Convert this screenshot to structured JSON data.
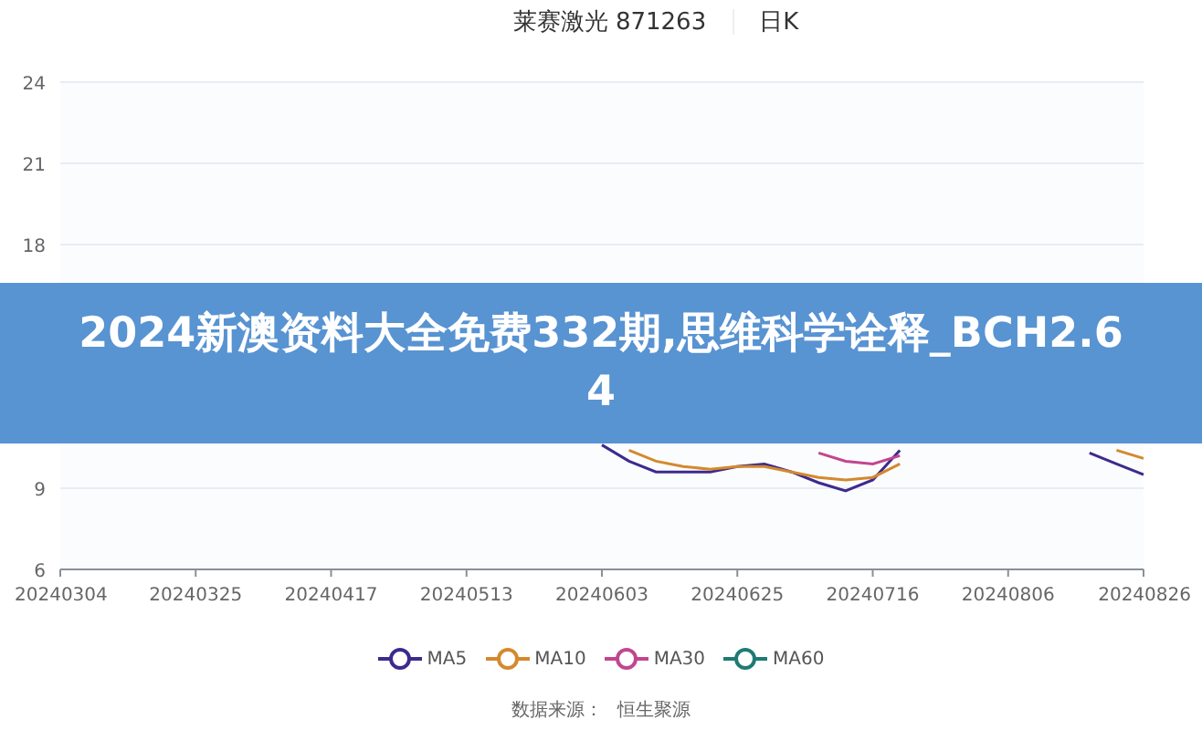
{
  "header": {
    "title": "莱赛激光 871263",
    "period": "日K"
  },
  "chart": {
    "chart_data": {
      "type": "line",
      "grid": true,
      "ylim": [
        6,
        24
      ],
      "yticks": [
        6,
        9,
        18,
        21,
        24
      ],
      "categories": [
        "20240304",
        null,
        null,
        null,
        null,
        "20240325",
        null,
        null,
        null,
        null,
        "20240417",
        null,
        null,
        null,
        null,
        "20240513",
        null,
        null,
        null,
        null,
        "20240603",
        null,
        null,
        null,
        null,
        "20240625",
        null,
        null,
        null,
        null,
        "20240716",
        null,
        null,
        null,
        null,
        "20240806",
        null,
        null,
        null,
        null,
        "20240826"
      ],
      "series": [
        {
          "name": "MA5",
          "color": "#3d2a8c",
          "values": [
            null,
            null,
            null,
            null,
            null,
            null,
            null,
            null,
            null,
            null,
            null,
            null,
            null,
            null,
            null,
            null,
            null,
            null,
            null,
            null,
            10.6,
            10.0,
            9.6,
            9.6,
            9.6,
            9.8,
            9.9,
            9.6,
            9.2,
            8.9,
            9.3,
            10.4,
            null,
            null,
            null,
            null,
            null,
            null,
            10.3,
            9.9,
            9.5
          ]
        },
        {
          "name": "MA10",
          "color": "#d4892e",
          "values": [
            null,
            null,
            null,
            null,
            null,
            null,
            null,
            null,
            null,
            null,
            null,
            null,
            null,
            null,
            null,
            null,
            null,
            null,
            null,
            null,
            null,
            10.4,
            10.0,
            9.8,
            9.7,
            9.8,
            9.8,
            9.6,
            9.4,
            9.3,
            9.4,
            9.9,
            null,
            null,
            null,
            null,
            null,
            null,
            null,
            10.4,
            10.1
          ]
        },
        {
          "name": "MA30",
          "color": "#c2468f",
          "values": [
            null,
            null,
            null,
            null,
            null,
            null,
            null,
            null,
            null,
            null,
            null,
            null,
            null,
            null,
            null,
            null,
            null,
            null,
            null,
            null,
            null,
            null,
            null,
            null,
            null,
            null,
            null,
            null,
            10.3,
            10.0,
            9.9,
            10.2,
            null,
            null,
            null,
            null,
            null,
            null,
            null,
            null,
            null
          ]
        },
        {
          "name": "MA60",
          "color": "#1f7a74",
          "values": [
            null,
            null,
            null,
            null,
            null,
            null,
            null,
            null,
            null,
            null,
            null,
            null,
            null,
            null,
            null,
            null,
            null,
            null,
            null,
            null,
            null,
            null,
            null,
            null,
            null,
            null,
            null,
            null,
            null,
            null,
            null,
            null,
            null,
            null,
            null,
            null,
            null,
            null,
            null,
            null,
            null
          ]
        }
      ]
    }
  },
  "banner": {
    "text": "2024新澳资料大全免费332期,思维科学诠释_BCH2.64"
  },
  "source": {
    "label": "数据来源：",
    "value": "恒生聚源"
  }
}
